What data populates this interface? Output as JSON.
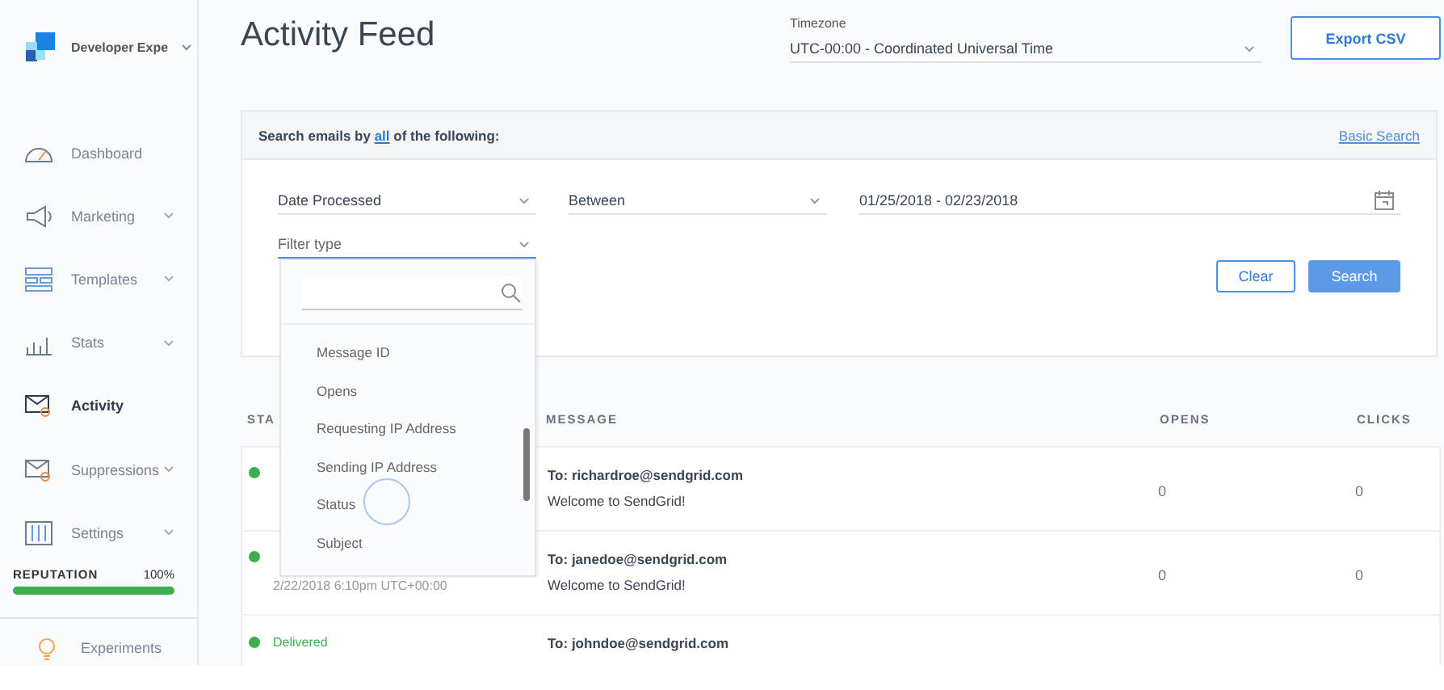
{
  "sidebar": {
    "brand": "Developer Expe",
    "items": [
      {
        "label": "Dashboard",
        "expandable": false,
        "selected": false
      },
      {
        "label": "Marketing",
        "expandable": true,
        "selected": false
      },
      {
        "label": "Templates",
        "expandable": true,
        "selected": false
      },
      {
        "label": "Stats",
        "expandable": true,
        "selected": false
      },
      {
        "label": "Activity",
        "expandable": false,
        "selected": true
      },
      {
        "label": "Suppressions",
        "expandable": true,
        "selected": false
      },
      {
        "label": "Settings",
        "expandable": true,
        "selected": false
      }
    ],
    "reputation": {
      "label": "REPUTATION",
      "value": "100%",
      "level": 1
    },
    "footer_item": "Experiments"
  },
  "header": {
    "title": "Activity Feed",
    "timezone_label": "Timezone",
    "timezone_value": "UTC-00:00 - Coordinated Universal Time",
    "export_button": "Export CSV"
  },
  "search": {
    "heading_before": "Search emails by",
    "heading_link": "all",
    "heading_after": "of the following:",
    "basic_search": "Basic Search",
    "field": "Date Processed",
    "operator": "Between",
    "date_range": "01/25/2018 - 02/23/2018",
    "filter_placeholder": "Filter type",
    "buttons": [
      {
        "label": "Clear",
        "kind": "secondary"
      },
      {
        "label": "Search",
        "kind": "primary"
      }
    ]
  },
  "dropdown": {
    "options": [
      "Message ID",
      "Opens",
      "Requesting IP Address",
      "Sending IP Address",
      "Status",
      "Subject"
    ]
  },
  "table": {
    "columns": [
      "STA",
      "MESSAGE",
      "OPENS",
      "CLICKS"
    ],
    "rows": [
      {
        "color": "#3dae4f",
        "to": "To: richardroe@sendgrid.com",
        "subject": "Welcome to SendGrid!",
        "opens": "0",
        "clicks": "0"
      },
      {
        "color": "#3dae4f",
        "date": "2/22/2018 6:10pm UTC+00:00",
        "to": "To: janedoe@sendgrid.com",
        "subject": "Welcome to SendGrid!",
        "opens": "0",
        "clicks": "0"
      },
      {
        "status": "Delivered",
        "color": "#3dae4f",
        "to": "To: johndoe@sendgrid.com"
      }
    ]
  }
}
